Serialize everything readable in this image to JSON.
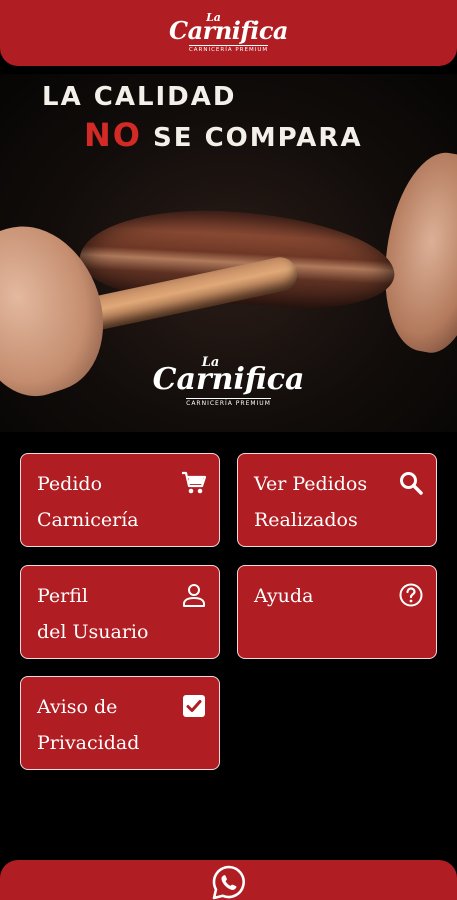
{
  "header": {
    "logo_la": "La",
    "logo_name": "Carnifica",
    "logo_sub": "CARNICERÍA PREMIUM"
  },
  "hero": {
    "headline_line1": "LA CALIDAD",
    "headline_no": "NO",
    "headline_rest": "SE COMPARA",
    "logo_la": "La",
    "logo_name": "Carnifica",
    "logo_sub": "CARNICERÍA PREMIUM"
  },
  "menu": {
    "pedido": "Pedido\nCarnicería",
    "ver_pedidos": "Ver Pedidos\nRealizados",
    "perfil": "Perfil\ndel Usuario",
    "ayuda": "Ayuda",
    "aviso": "Aviso de\nPrivacidad"
  },
  "colors": {
    "brand_red": "#b01d22",
    "background": "#000000"
  },
  "icons": {
    "pedido": "cart-icon",
    "ver_pedidos": "search-icon",
    "perfil": "user-icon",
    "ayuda": "help-icon",
    "aviso": "checkbox-icon",
    "footer": "whatsapp-icon"
  }
}
